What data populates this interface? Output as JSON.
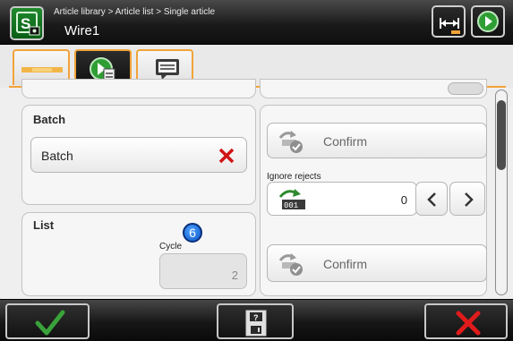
{
  "header": {
    "breadcrumb": "Article library > Article list > Single article",
    "title": "Wire1"
  },
  "batch": {
    "title": "Batch",
    "button_label": "Batch"
  },
  "list": {
    "title": "List",
    "cycle_label": "Cycle",
    "cycle_value": "2",
    "badge": "6"
  },
  "right": {
    "confirm_top_label": "Confirm",
    "ignore_rejects_label": "Ignore rejects",
    "ignore_rejects_value": "0",
    "confirm_bottom_label": "Confirm"
  },
  "colors": {
    "tab_accent": "#f2a33a",
    "header_bg": "#1b1b1b",
    "confirm_green": "#3aa23a",
    "cancel_red": "#e01b1b"
  },
  "icons": {
    "app": "app-logo-icon",
    "header_right": [
      "width-measure-icon",
      "next-arrow-icon"
    ],
    "tabs": [
      "wire-icon",
      "article-settings-icon",
      "message-icon"
    ],
    "bottom": [
      "checkmark-icon",
      "save-disk-icon",
      "cancel-x-icon"
    ]
  }
}
